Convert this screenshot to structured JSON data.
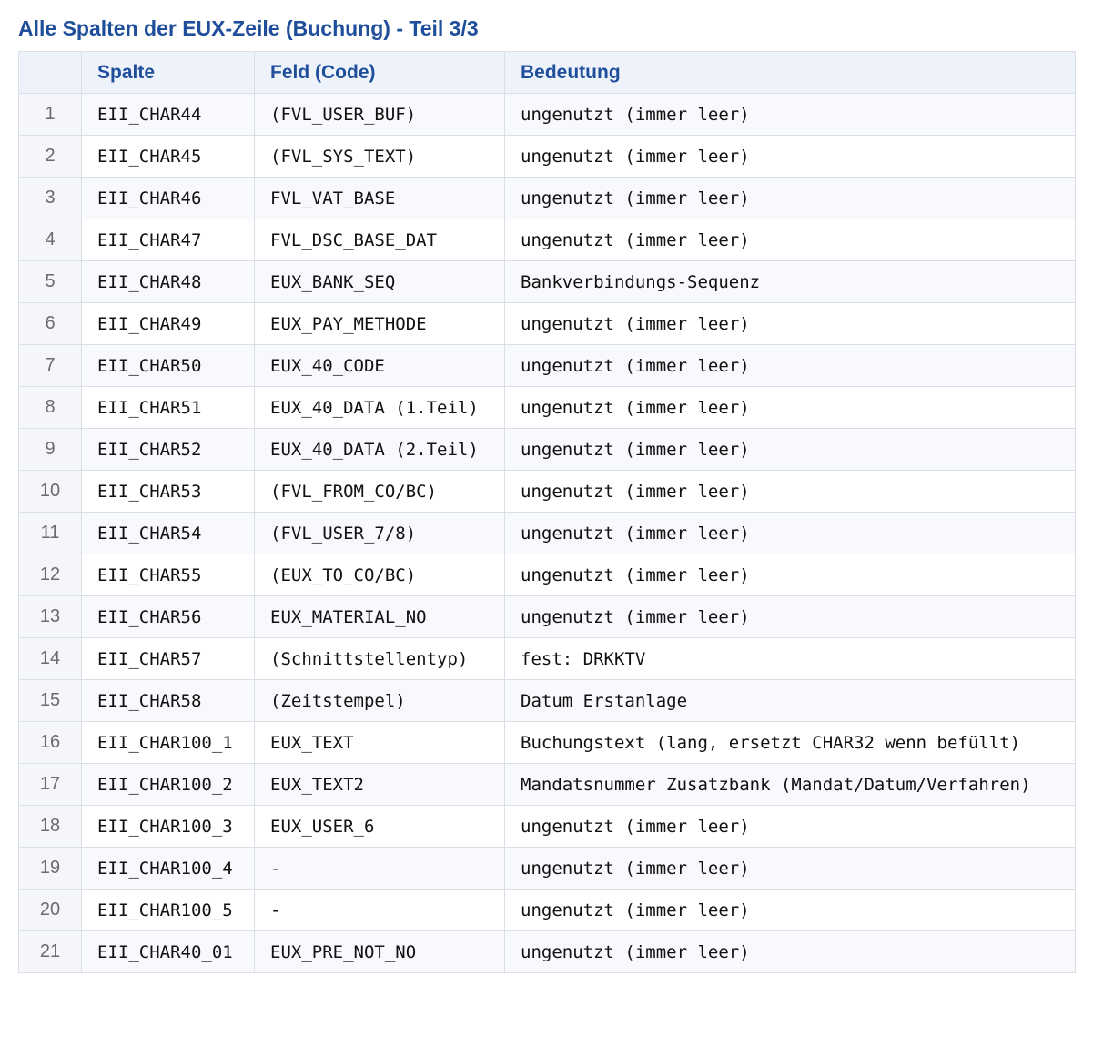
{
  "title": "Alle Spalten der EUX-Zeile (Buchung) - Teil 3/3",
  "columns": {
    "index": "",
    "spalte": "Spalte",
    "feld": "Feld (Code)",
    "bedeutung": "Bedeutung"
  },
  "rows": [
    {
      "index": "1",
      "spalte": "EII_CHAR44",
      "feld": "(FVL_USER_BUF)",
      "bedeutung": "ungenutzt (immer leer)"
    },
    {
      "index": "2",
      "spalte": "EII_CHAR45",
      "feld": "(FVL_SYS_TEXT)",
      "bedeutung": "ungenutzt (immer leer)"
    },
    {
      "index": "3",
      "spalte": "EII_CHAR46",
      "feld": "FVL_VAT_BASE",
      "bedeutung": "ungenutzt (immer leer)"
    },
    {
      "index": "4",
      "spalte": "EII_CHAR47",
      "feld": "FVL_DSC_BASE_DAT",
      "bedeutung": "ungenutzt (immer leer)"
    },
    {
      "index": "5",
      "spalte": "EII_CHAR48",
      "feld": "EUX_BANK_SEQ",
      "bedeutung": "Bankverbindungs-Sequenz"
    },
    {
      "index": "6",
      "spalte": "EII_CHAR49",
      "feld": "EUX_PAY_METHODE",
      "bedeutung": "ungenutzt (immer leer)"
    },
    {
      "index": "7",
      "spalte": "EII_CHAR50",
      "feld": "EUX_40_CODE",
      "bedeutung": "ungenutzt (immer leer)"
    },
    {
      "index": "8",
      "spalte": "EII_CHAR51",
      "feld": "EUX_40_DATA (1.Teil)",
      "bedeutung": "ungenutzt (immer leer)"
    },
    {
      "index": "9",
      "spalte": "EII_CHAR52",
      "feld": "EUX_40_DATA (2.Teil)",
      "bedeutung": "ungenutzt (immer leer)"
    },
    {
      "index": "10",
      "spalte": "EII_CHAR53",
      "feld": "(FVL_FROM_CO/BC)",
      "bedeutung": "ungenutzt (immer leer)"
    },
    {
      "index": "11",
      "spalte": "EII_CHAR54",
      "feld": "(FVL_USER_7/8)",
      "bedeutung": "ungenutzt (immer leer)"
    },
    {
      "index": "12",
      "spalte": "EII_CHAR55",
      "feld": "(EUX_TO_CO/BC)",
      "bedeutung": "ungenutzt (immer leer)"
    },
    {
      "index": "13",
      "spalte": "EII_CHAR56",
      "feld": "EUX_MATERIAL_NO",
      "bedeutung": "ungenutzt (immer leer)"
    },
    {
      "index": "14",
      "spalte": "EII_CHAR57",
      "feld": "(Schnittstellentyp)",
      "bedeutung": "fest: DRKKTV"
    },
    {
      "index": "15",
      "spalte": "EII_CHAR58",
      "feld": "(Zeitstempel)",
      "bedeutung": "Datum Erstanlage"
    },
    {
      "index": "16",
      "spalte": "EII_CHAR100_1",
      "feld": "EUX_TEXT",
      "bedeutung": "Buchungstext (lang, ersetzt CHAR32 wenn befüllt)"
    },
    {
      "index": "17",
      "spalte": "EII_CHAR100_2",
      "feld": "EUX_TEXT2",
      "bedeutung": "Mandatsnummer Zusatzbank (Mandat/Datum/Verfahren)"
    },
    {
      "index": "18",
      "spalte": "EII_CHAR100_3",
      "feld": "EUX_USER_6",
      "bedeutung": "ungenutzt (immer leer)"
    },
    {
      "index": "19",
      "spalte": "EII_CHAR100_4",
      "feld": "-",
      "bedeutung": "ungenutzt (immer leer)"
    },
    {
      "index": "20",
      "spalte": "EII_CHAR100_5",
      "feld": "-",
      "bedeutung": "ungenutzt (immer leer)"
    },
    {
      "index": "21",
      "spalte": "EII_CHAR40_01",
      "feld": "EUX_PRE_NOT_NO",
      "bedeutung": "ungenutzt (immer leer)"
    }
  ],
  "colors": {
    "title": "#1f4e9b",
    "header_background": "#eef3fb",
    "border": "#d9dee7",
    "index_text": "#6b6b6b"
  }
}
